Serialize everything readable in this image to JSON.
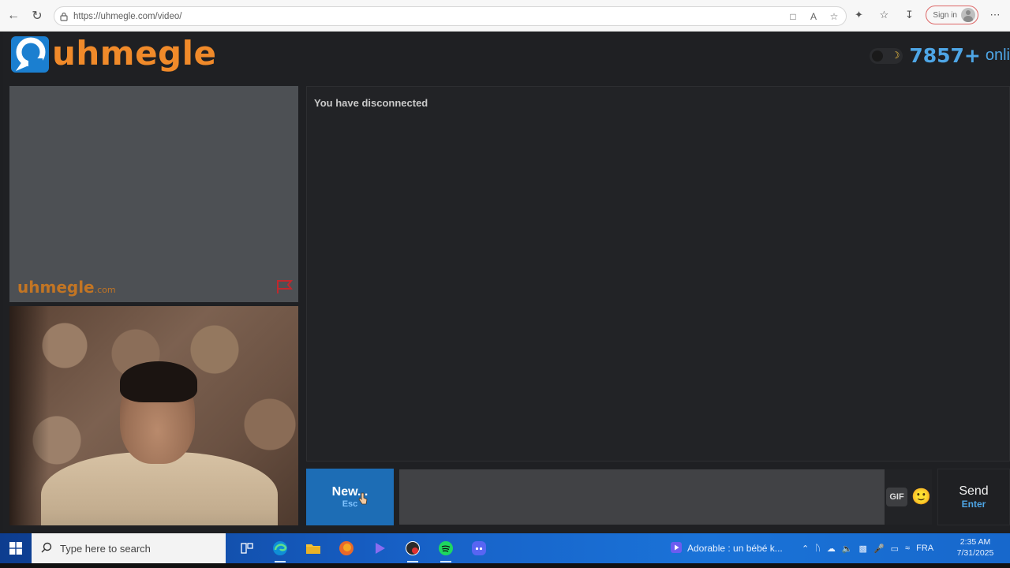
{
  "browser": {
    "url": "https://uhmegle.com/video/",
    "signin_label": "Sign in"
  },
  "site": {
    "logo_text": "uhmegle",
    "online_count": "7857+",
    "online_label": "onli",
    "brand_orange": "#f08a2a",
    "brand_blue": "#4ea6e6"
  },
  "stranger_video": {
    "watermark": "uhmegle",
    "watermark_suffix": ".com"
  },
  "chat": {
    "status_message": "You have disconnected",
    "input_value": "",
    "gif_label": "GIF",
    "emoji": "🙂"
  },
  "controls": {
    "new_label": "New...",
    "new_shortcut": "Esc",
    "send_label": "Send",
    "send_shortcut": "Enter"
  },
  "taskbar": {
    "search_placeholder": "Type here to search",
    "media_title": "Adorable : un bébé k...",
    "language": "FRA",
    "time": "2:35 AM",
    "date": "7/31/2025"
  }
}
